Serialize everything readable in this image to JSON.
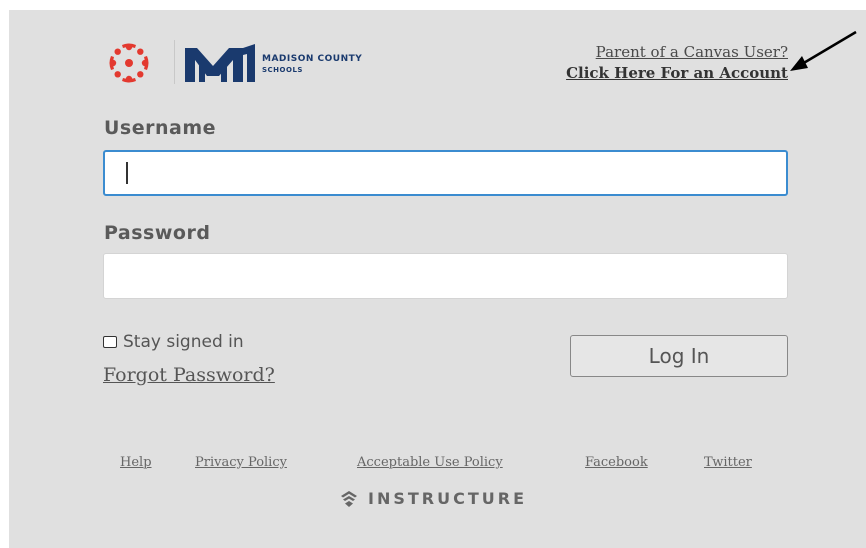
{
  "header": {
    "school_name_line1": "MADISON COUNTY",
    "school_name_line2": "SCHOOLS",
    "parent_link_line1": "Parent of a Canvas User?",
    "parent_link_line2": "Click Here For an Account"
  },
  "form": {
    "username_label": "Username",
    "username_value": "",
    "password_label": "Password",
    "password_value": "",
    "stay_signed_in_label": "Stay signed in",
    "stay_signed_in_checked": false,
    "forgot_password_label": "Forgot Password?",
    "login_button_label": "Log In"
  },
  "footer": {
    "links": [
      "Help",
      "Privacy Policy",
      "Acceptable Use Policy",
      "Facebook",
      "Twitter"
    ],
    "brand": "INSTRUCTURE"
  },
  "icons": {
    "canvas_logo": "canvas-logo-icon",
    "school_logo": "madison-county-logo-icon",
    "instructure_logo": "instructure-logo-icon",
    "annotation_arrow": "arrow-icon"
  },
  "colors": {
    "canvas_red": "#e3392f",
    "school_navy": "#1a3a6e",
    "focus_blue": "#3b8cd0",
    "panel_bg": "#e0e0e0"
  }
}
